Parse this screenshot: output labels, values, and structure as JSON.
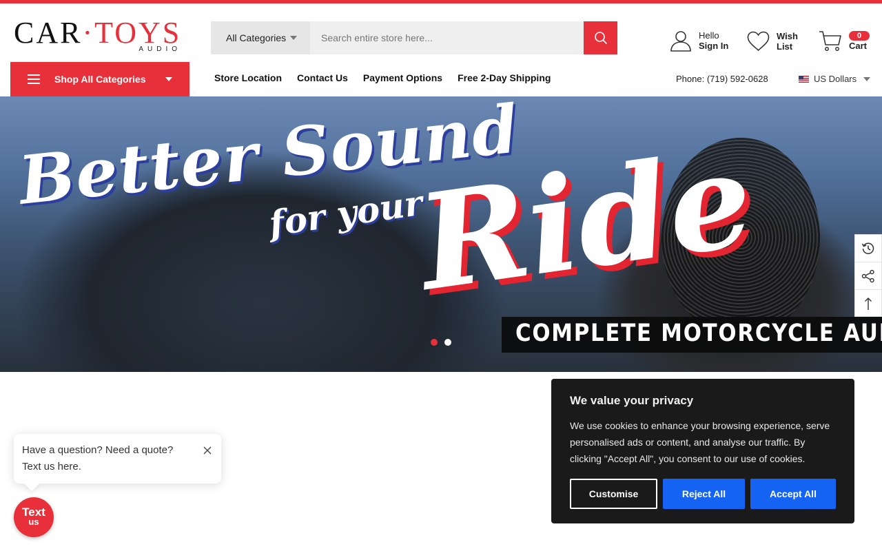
{
  "logo": {
    "word_left": "CAR",
    "word_right": "TOYS",
    "subtitle": "AUDIO"
  },
  "search": {
    "category_label": "All Categories",
    "placeholder": "Search entire store here..."
  },
  "account": {
    "greeting": "Hello",
    "sign_in": "Sign In"
  },
  "wishlist": {
    "line1": "Wish",
    "line2": "List"
  },
  "cart": {
    "count": "0",
    "label": "Cart"
  },
  "shop_all": {
    "label": "Shop All Categories"
  },
  "menu": [
    {
      "label": "Store Location"
    },
    {
      "label": "Contact Us"
    },
    {
      "label": "Payment Options"
    },
    {
      "label": "Free 2-Day Shipping"
    }
  ],
  "phone": "Phone: (719) 592-0628",
  "currency": "US Dollars",
  "banner": {
    "headline_1": "Better Sound",
    "headline_2": "for your",
    "headline_3": "Ride",
    "caption": "COMPLETE MOTORCYCLE AUDIO KITS",
    "slides": [
      {
        "active": true
      },
      {
        "active": false
      }
    ]
  },
  "cookie": {
    "title": "We value your privacy",
    "body": "We use cookies to enhance your browsing experience, serve personalised ads or content, and analyse our traffic. By clicking \"Accept All\", you consent to our use of cookies.",
    "customise": "Customise",
    "reject": "Reject All",
    "accept": "Accept All"
  },
  "chat": {
    "bubble": "Have a question? Need a quote? Text us here.",
    "button_line1": "Text",
    "button_line2": "us"
  },
  "colors": {
    "brand_red": "#e8303a",
    "cookie_bg": "#1a1a1a",
    "cookie_button": "#1463f3"
  }
}
